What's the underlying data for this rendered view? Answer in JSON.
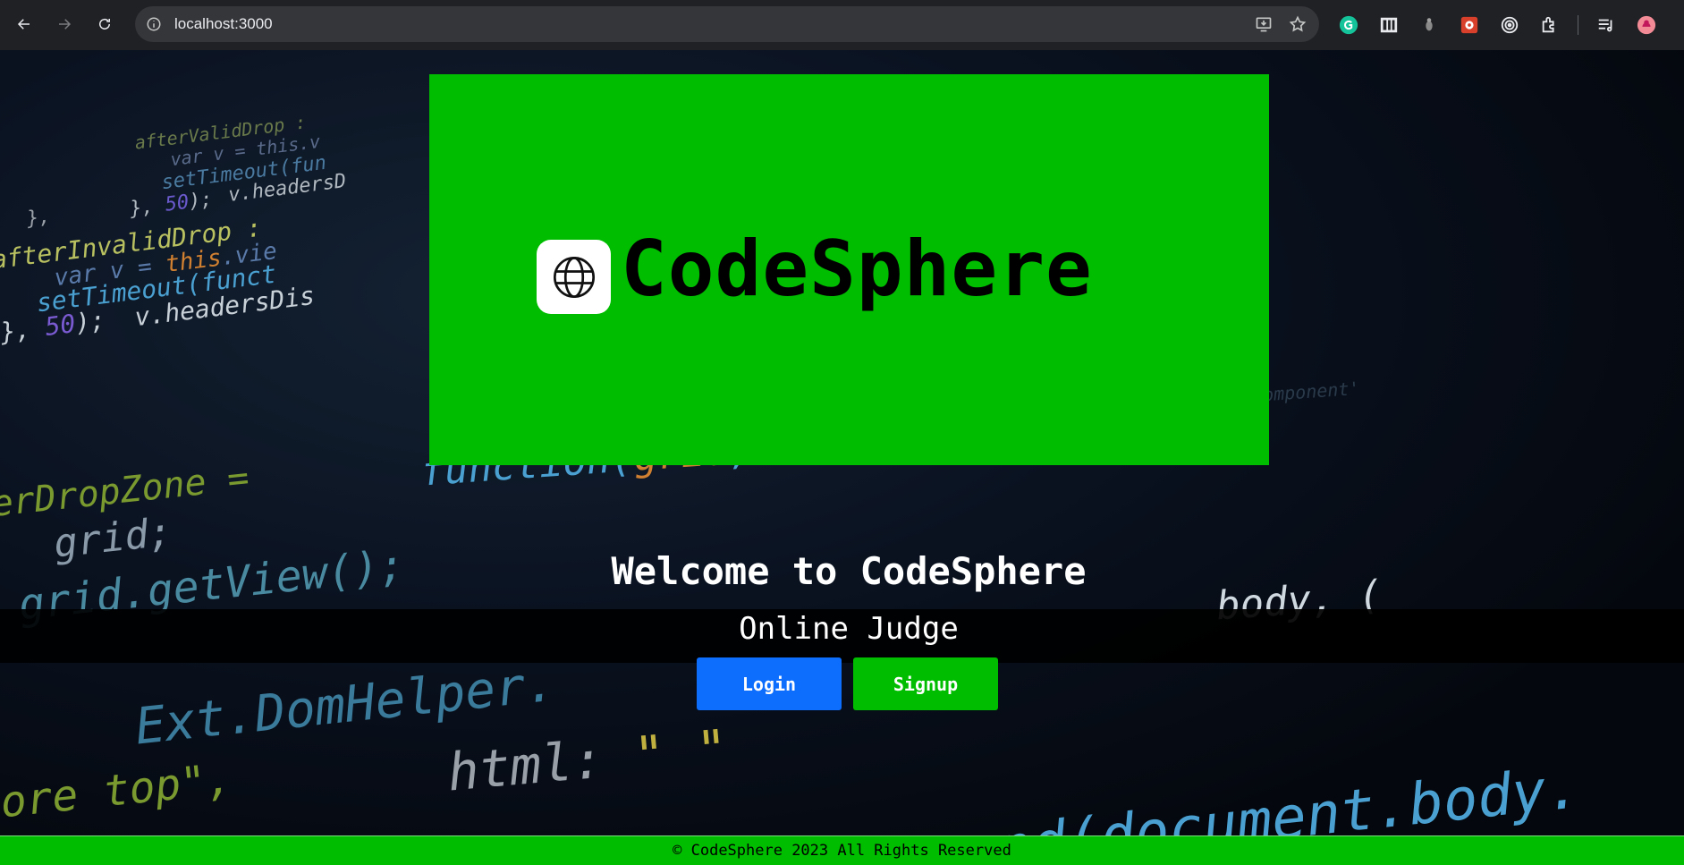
{
  "browser": {
    "url": "localhost:3000",
    "icons": {
      "back": "back-arrow-icon",
      "forward": "forward-arrow-icon",
      "reload": "reload-icon",
      "site_info": "site-info-icon",
      "install": "install-app-icon",
      "bookmark": "star-icon"
    },
    "extensions": [
      "grammarly-icon",
      "reader-icon",
      "extension-icon",
      "extension-icon",
      "extension-icon",
      "puzzle-extensions-icon",
      "media-control-icon",
      "profile-avatar"
    ]
  },
  "banner": {
    "logo_text": "CodeSphere",
    "logo_icon": "globe-icon",
    "background": "#00bd00"
  },
  "hero": {
    "welcome": "Welcome to CodeSphere",
    "subtitle": "Online Judge"
  },
  "buttons": {
    "login": "Login",
    "signup": "Signup",
    "login_color": "#0d6efd",
    "signup_color": "#00bd00"
  },
  "footer": {
    "text": "© CodeSphere 2023 All Rights Reserved"
  }
}
